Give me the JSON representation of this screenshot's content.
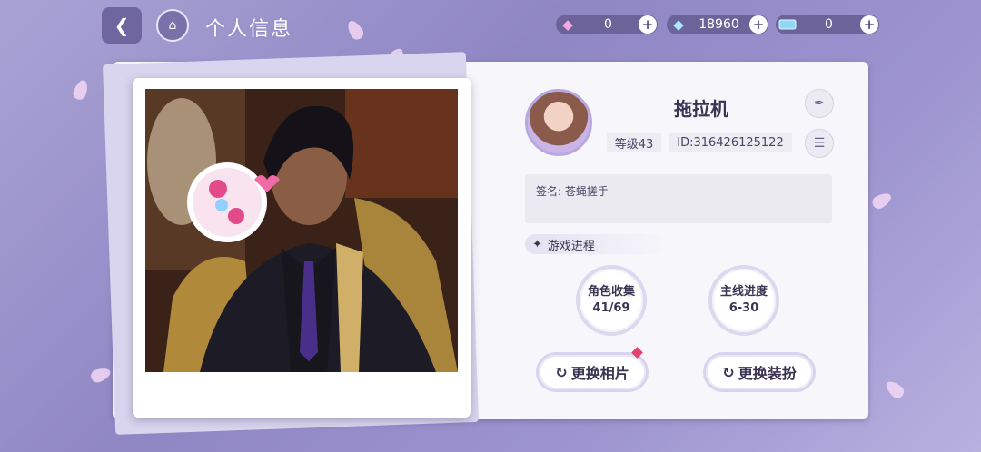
{
  "header": {
    "title": "个人信息"
  },
  "currencies": [
    {
      "icon": "pink-diamond-icon",
      "value": "0"
    },
    {
      "icon": "blue-diamond-icon",
      "value": "18960"
    },
    {
      "icon": "ticket-icon",
      "value": "0"
    }
  ],
  "profile": {
    "nickname": "拖拉机",
    "level": "等级43",
    "id": "ID:316426125122",
    "signature": "签名: 苍蝇搓手"
  },
  "progress": {
    "heading": "游戏进程",
    "stats": [
      {
        "label": "角色收集",
        "value": "41/69"
      },
      {
        "label": "主线进度",
        "value": "6-30"
      }
    ]
  },
  "actions": {
    "change_photo": "更换相片",
    "change_outfit": "更换装扮"
  },
  "colors": {
    "background": "#9c93cf",
    "card": "#f7f6fb",
    "accent": "#6c6498",
    "notification": "#e6426b"
  }
}
